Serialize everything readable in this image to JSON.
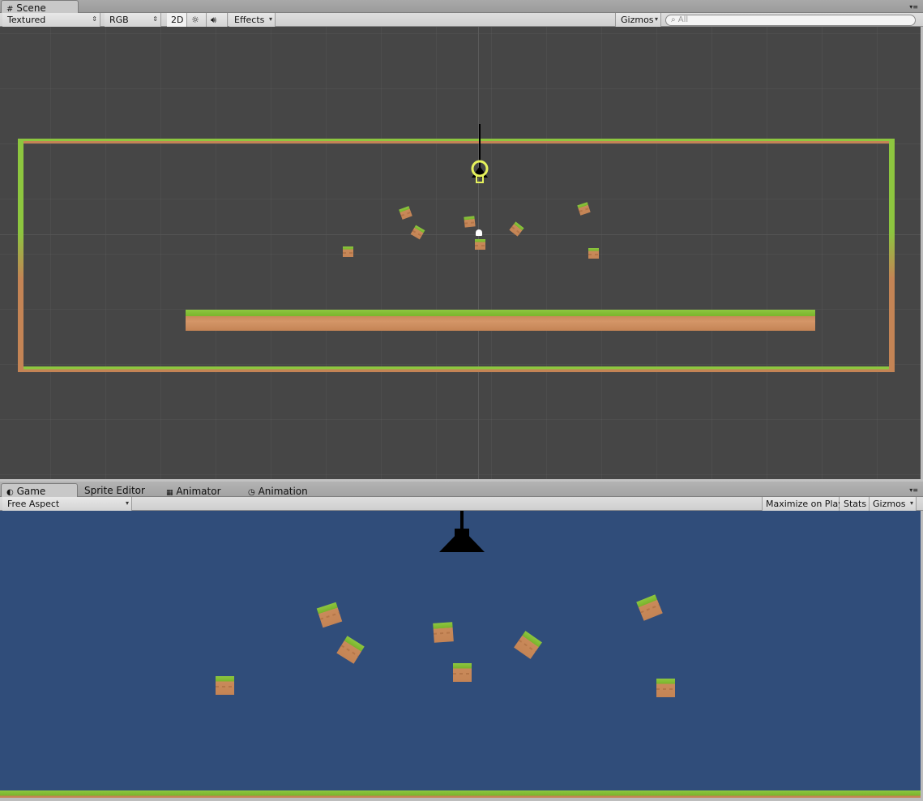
{
  "scene_tab": {
    "label": "Scene",
    "icon": "grid-icon"
  },
  "scene_toolbar": {
    "draw_mode": "Textured",
    "render_mode": "RGB",
    "mode_2d": "2D",
    "effects": "Effects",
    "gizmos": "Gizmos",
    "search_placeholder": "All"
  },
  "bottom_tabs": [
    {
      "label": "Game",
      "icon": "game-icon"
    },
    {
      "label": "Sprite Editor"
    },
    {
      "label": "Animator",
      "icon": "animator-icon"
    },
    {
      "label": "Animation",
      "icon": "clock-icon"
    }
  ],
  "game_toolbar": {
    "aspect": "Free Aspect",
    "maximize": "Maximize on Play",
    "stats": "Stats",
    "gizmos": "Gizmos"
  },
  "colors": {
    "scene_background": "#464646",
    "game_background": "#304d7a",
    "grass": "#8dc63f",
    "dirt": "#c48455",
    "light_gizmo": "#e6f25c"
  }
}
